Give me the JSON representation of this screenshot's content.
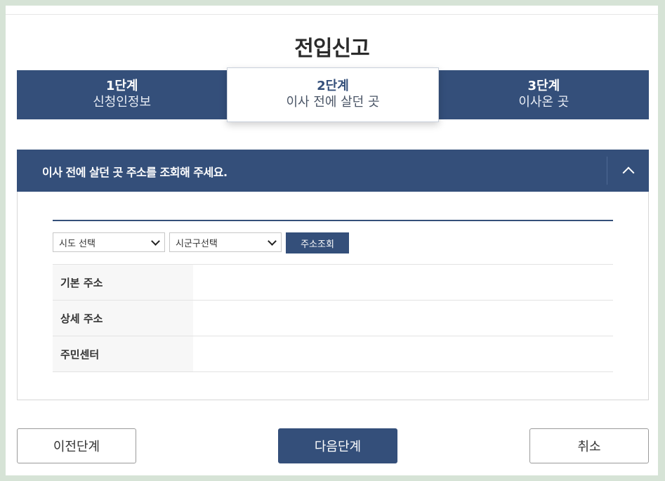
{
  "page": {
    "title": "전입신고"
  },
  "steps": [
    {
      "number": "1단계",
      "label": "신청인정보",
      "active": false
    },
    {
      "number": "2단계",
      "label": "이사 전에 살던 곳",
      "active": true
    },
    {
      "number": "3단계",
      "label": "이사온 곳",
      "active": false
    }
  ],
  "panel": {
    "heading": "이사 전에 살던 곳 주소를 조회해 주세요.",
    "sido_select": "시도 선택",
    "sigungu_select": "시군구선택",
    "search_button": "주소조회",
    "rows": [
      {
        "label": "기본 주소",
        "value": ""
      },
      {
        "label": "상세 주소",
        "value": ""
      },
      {
        "label": "주민센터",
        "value": ""
      }
    ]
  },
  "footer": {
    "prev_label": "이전단계",
    "next_label": "다음단계",
    "cancel_label": "취소"
  },
  "colors": {
    "primary": "#344f7a",
    "background": "#d6e3d6"
  }
}
